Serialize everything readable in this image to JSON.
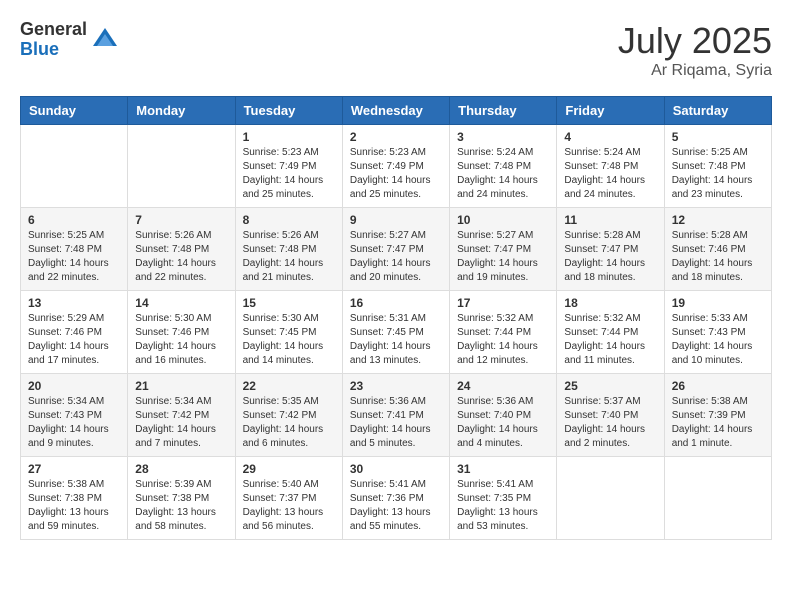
{
  "header": {
    "logo_general": "General",
    "logo_blue": "Blue",
    "month_year": "July 2025",
    "location": "Ar Riqama, Syria"
  },
  "days_of_week": [
    "Sunday",
    "Monday",
    "Tuesday",
    "Wednesday",
    "Thursday",
    "Friday",
    "Saturday"
  ],
  "weeks": [
    [
      {
        "day": "",
        "sunrise": "",
        "sunset": "",
        "daylight": ""
      },
      {
        "day": "",
        "sunrise": "",
        "sunset": "",
        "daylight": ""
      },
      {
        "day": "1",
        "sunrise": "Sunrise: 5:23 AM",
        "sunset": "Sunset: 7:49 PM",
        "daylight": "Daylight: 14 hours and 25 minutes."
      },
      {
        "day": "2",
        "sunrise": "Sunrise: 5:23 AM",
        "sunset": "Sunset: 7:49 PM",
        "daylight": "Daylight: 14 hours and 25 minutes."
      },
      {
        "day": "3",
        "sunrise": "Sunrise: 5:24 AM",
        "sunset": "Sunset: 7:48 PM",
        "daylight": "Daylight: 14 hours and 24 minutes."
      },
      {
        "day": "4",
        "sunrise": "Sunrise: 5:24 AM",
        "sunset": "Sunset: 7:48 PM",
        "daylight": "Daylight: 14 hours and 24 minutes."
      },
      {
        "day": "5",
        "sunrise": "Sunrise: 5:25 AM",
        "sunset": "Sunset: 7:48 PM",
        "daylight": "Daylight: 14 hours and 23 minutes."
      }
    ],
    [
      {
        "day": "6",
        "sunrise": "Sunrise: 5:25 AM",
        "sunset": "Sunset: 7:48 PM",
        "daylight": "Daylight: 14 hours and 22 minutes."
      },
      {
        "day": "7",
        "sunrise": "Sunrise: 5:26 AM",
        "sunset": "Sunset: 7:48 PM",
        "daylight": "Daylight: 14 hours and 22 minutes."
      },
      {
        "day": "8",
        "sunrise": "Sunrise: 5:26 AM",
        "sunset": "Sunset: 7:48 PM",
        "daylight": "Daylight: 14 hours and 21 minutes."
      },
      {
        "day": "9",
        "sunrise": "Sunrise: 5:27 AM",
        "sunset": "Sunset: 7:47 PM",
        "daylight": "Daylight: 14 hours and 20 minutes."
      },
      {
        "day": "10",
        "sunrise": "Sunrise: 5:27 AM",
        "sunset": "Sunset: 7:47 PM",
        "daylight": "Daylight: 14 hours and 19 minutes."
      },
      {
        "day": "11",
        "sunrise": "Sunrise: 5:28 AM",
        "sunset": "Sunset: 7:47 PM",
        "daylight": "Daylight: 14 hours and 18 minutes."
      },
      {
        "day": "12",
        "sunrise": "Sunrise: 5:28 AM",
        "sunset": "Sunset: 7:46 PM",
        "daylight": "Daylight: 14 hours and 18 minutes."
      }
    ],
    [
      {
        "day": "13",
        "sunrise": "Sunrise: 5:29 AM",
        "sunset": "Sunset: 7:46 PM",
        "daylight": "Daylight: 14 hours and 17 minutes."
      },
      {
        "day": "14",
        "sunrise": "Sunrise: 5:30 AM",
        "sunset": "Sunset: 7:46 PM",
        "daylight": "Daylight: 14 hours and 16 minutes."
      },
      {
        "day": "15",
        "sunrise": "Sunrise: 5:30 AM",
        "sunset": "Sunset: 7:45 PM",
        "daylight": "Daylight: 14 hours and 14 minutes."
      },
      {
        "day": "16",
        "sunrise": "Sunrise: 5:31 AM",
        "sunset": "Sunset: 7:45 PM",
        "daylight": "Daylight: 14 hours and 13 minutes."
      },
      {
        "day": "17",
        "sunrise": "Sunrise: 5:32 AM",
        "sunset": "Sunset: 7:44 PM",
        "daylight": "Daylight: 14 hours and 12 minutes."
      },
      {
        "day": "18",
        "sunrise": "Sunrise: 5:32 AM",
        "sunset": "Sunset: 7:44 PM",
        "daylight": "Daylight: 14 hours and 11 minutes."
      },
      {
        "day": "19",
        "sunrise": "Sunrise: 5:33 AM",
        "sunset": "Sunset: 7:43 PM",
        "daylight": "Daylight: 14 hours and 10 minutes."
      }
    ],
    [
      {
        "day": "20",
        "sunrise": "Sunrise: 5:34 AM",
        "sunset": "Sunset: 7:43 PM",
        "daylight": "Daylight: 14 hours and 9 minutes."
      },
      {
        "day": "21",
        "sunrise": "Sunrise: 5:34 AM",
        "sunset": "Sunset: 7:42 PM",
        "daylight": "Daylight: 14 hours and 7 minutes."
      },
      {
        "day": "22",
        "sunrise": "Sunrise: 5:35 AM",
        "sunset": "Sunset: 7:42 PM",
        "daylight": "Daylight: 14 hours and 6 minutes."
      },
      {
        "day": "23",
        "sunrise": "Sunrise: 5:36 AM",
        "sunset": "Sunset: 7:41 PM",
        "daylight": "Daylight: 14 hours and 5 minutes."
      },
      {
        "day": "24",
        "sunrise": "Sunrise: 5:36 AM",
        "sunset": "Sunset: 7:40 PM",
        "daylight": "Daylight: 14 hours and 4 minutes."
      },
      {
        "day": "25",
        "sunrise": "Sunrise: 5:37 AM",
        "sunset": "Sunset: 7:40 PM",
        "daylight": "Daylight: 14 hours and 2 minutes."
      },
      {
        "day": "26",
        "sunrise": "Sunrise: 5:38 AM",
        "sunset": "Sunset: 7:39 PM",
        "daylight": "Daylight: 14 hours and 1 minute."
      }
    ],
    [
      {
        "day": "27",
        "sunrise": "Sunrise: 5:38 AM",
        "sunset": "Sunset: 7:38 PM",
        "daylight": "Daylight: 13 hours and 59 minutes."
      },
      {
        "day": "28",
        "sunrise": "Sunrise: 5:39 AM",
        "sunset": "Sunset: 7:38 PM",
        "daylight": "Daylight: 13 hours and 58 minutes."
      },
      {
        "day": "29",
        "sunrise": "Sunrise: 5:40 AM",
        "sunset": "Sunset: 7:37 PM",
        "daylight": "Daylight: 13 hours and 56 minutes."
      },
      {
        "day": "30",
        "sunrise": "Sunrise: 5:41 AM",
        "sunset": "Sunset: 7:36 PM",
        "daylight": "Daylight: 13 hours and 55 minutes."
      },
      {
        "day": "31",
        "sunrise": "Sunrise: 5:41 AM",
        "sunset": "Sunset: 7:35 PM",
        "daylight": "Daylight: 13 hours and 53 minutes."
      },
      {
        "day": "",
        "sunrise": "",
        "sunset": "",
        "daylight": ""
      },
      {
        "day": "",
        "sunrise": "",
        "sunset": "",
        "daylight": ""
      }
    ]
  ]
}
